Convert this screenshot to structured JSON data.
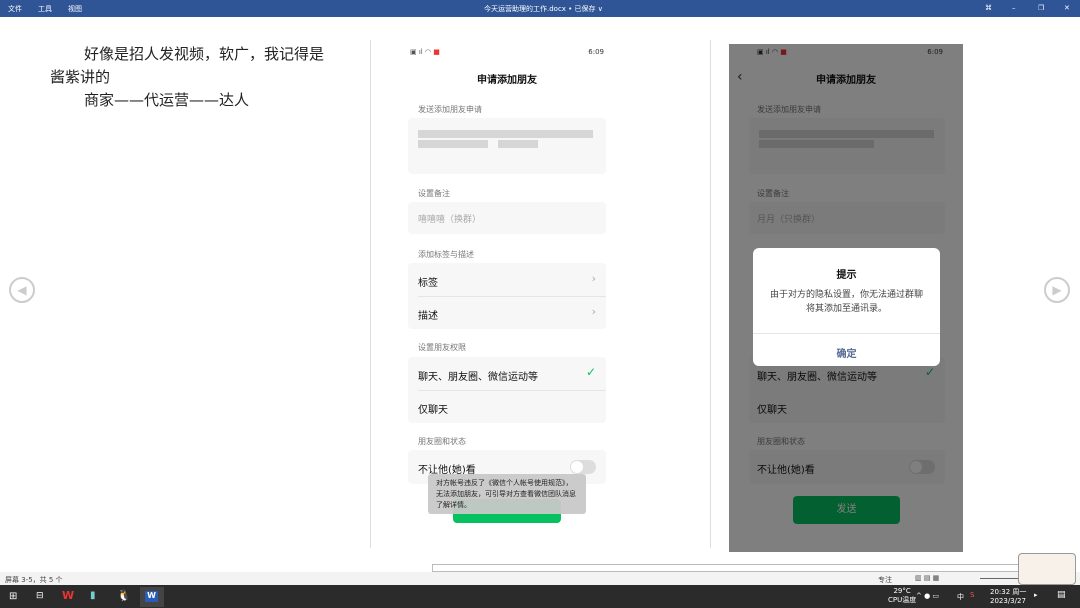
{
  "titlebar": {
    "menus": [
      "文件",
      "工具",
      "视图"
    ],
    "title": "今天运营助理的工作.docx • 已保存 ∨",
    "controls": [
      "⌘",
      "–",
      "❐",
      "✕"
    ]
  },
  "document": {
    "lines": [
      "好像是招人发视频，软广，我记得是",
      "酱紫讲的",
      "商家——代运营——达人"
    ]
  },
  "phone1": {
    "status_time": "6:09",
    "title": "申请添加朋友",
    "send_label": "发送添加朋友申请",
    "remark_label": "设置备注",
    "remark_value": "嘻嘻嘻（换群）",
    "tags_section": "添加标签与描述",
    "tag": "标签",
    "desc": "描述",
    "perm_section": "设置朋友权限",
    "perm_all": "聊天、朋友圈、微信运动等",
    "perm_chat": "仅聊天",
    "moments_section": "朋友圈和状态",
    "hide_label": "不让他(她)看",
    "toast": "对方帐号违反了《微信个人帐号使用规范》，无法添加朋友，可引导对方查看微信团队消息了解详情。"
  },
  "phone2": {
    "status_time": "6:09",
    "title": "申请添加朋友",
    "send_label": "发送添加朋友申请",
    "remark_label": "设置备注",
    "remark_value": "月月（只换群）",
    "perm_all": "聊天、朋友圈、微信运动等",
    "perm_chat": "仅聊天",
    "moments_section": "朋友圈和状态",
    "hide_label": "不让他(她)看",
    "send_button": "发送",
    "dialog": {
      "title": "提示",
      "message": "由于对方的隐私设置，你无法通过群聊将其添加至通讯录。",
      "confirm": "确定"
    }
  },
  "statusbar": {
    "page_info": "屏幕 3-5，共 5 个",
    "focus": "专注"
  },
  "taskbar": {
    "temp": "29°C",
    "temp_label": "CPU温度",
    "ime": "中",
    "time": "20:32 周一",
    "date": "2023/3/27"
  }
}
